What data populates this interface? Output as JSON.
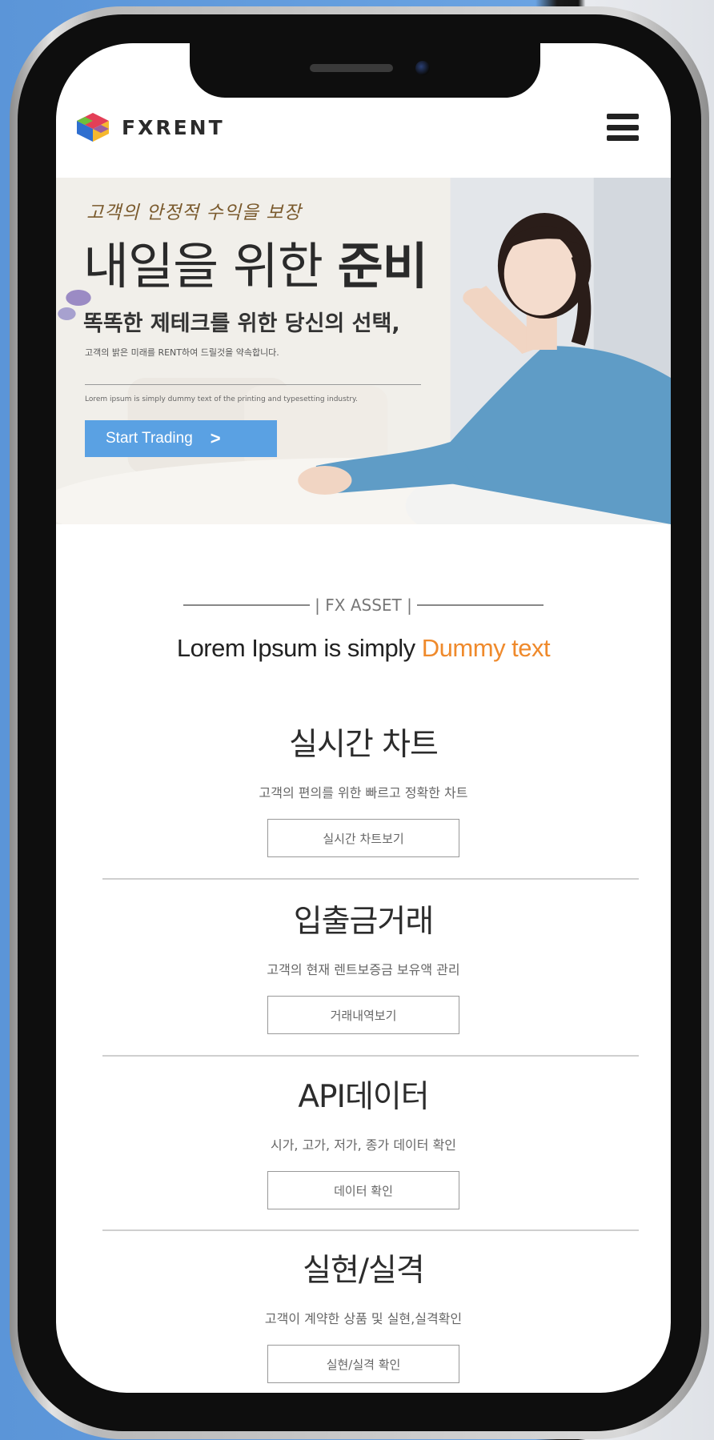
{
  "app": {
    "logo_text": "FXRENT",
    "menu_icon": "hamburger-icon"
  },
  "hero": {
    "tagline": "고객의 안정적 수익을 보장",
    "title_light": "내일을 위한 ",
    "title_bold": "준비",
    "subtitle": "똑똑한 제테크를 위한 당신의 선택,",
    "small_text": "고객의 밝은 미래를 RENT하여 드릴것을 약속합니다.",
    "lorem": "Lorem ipsum is simply dummy text of the printing and typesetting industry.",
    "cta_label": "Start Trading",
    "cta_icon": "chevron-right-icon"
  },
  "section": {
    "label": "| FX ASSET |",
    "headline_plain": "Lorem Ipsum is simply ",
    "headline_accent": "Dummy text"
  },
  "features": [
    {
      "title": "실시간 차트",
      "desc": "고객의 편의를 위한 빠르고 정확한 차트",
      "button": "실시간 차트보기"
    },
    {
      "title": "입출금거래",
      "desc": "고객의 현재 렌트보증금 보유액 관리",
      "button": "거래내역보기"
    },
    {
      "title": "API데이터",
      "desc": "시가, 고가, 저가, 종가 데이터 확인",
      "button": "데이터 확인"
    },
    {
      "title": "실현/실격",
      "desc": "고객이 계약한 상품 및 실현,실격확인",
      "button": "실현/실격 확인"
    }
  ],
  "colors": {
    "accent": "#ef8a2c",
    "cta": "#5aa1e3",
    "background_blue": "#5b95d8"
  }
}
